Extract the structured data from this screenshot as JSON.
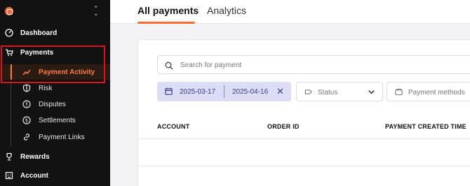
{
  "sidebar": {
    "nav": {
      "dashboard": "Dashboard",
      "payments": "Payments",
      "rewards": "Rewards",
      "account": "Account"
    },
    "payments_sub": {
      "payment_activity": "Payment Activity",
      "risk": "Risk",
      "disputes": "Disputes",
      "settlements": "Settlements",
      "payment_links": "Payment Links"
    }
  },
  "tabs": {
    "payments": "All payments",
    "analytics": "Analytics"
  },
  "search": {
    "placeholder": "Search for payment"
  },
  "filters": {
    "date_start": "2025-03-17",
    "date_end": "2025-04-16",
    "clear": "✕",
    "status_label": "Status",
    "payment_methods_label": "Payment methods"
  },
  "table": {
    "columns": [
      "ACCOUNT",
      "ORDER ID",
      "PAYMENT CREATED TIME"
    ]
  },
  "colors": {
    "accent": "#ff6a33",
    "highlight_box": "#e0111a",
    "date_chip_bg": "#dcdcf7"
  }
}
